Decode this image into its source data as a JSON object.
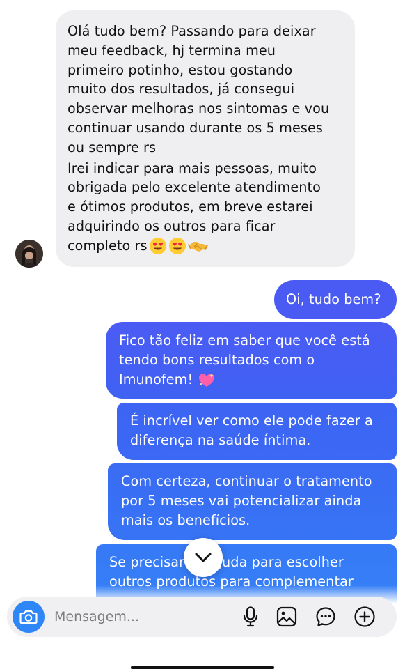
{
  "conversation": {
    "incoming": {
      "paragraph1_lines": [
        "Olá tudo bem? Passando para deixar",
        "meu feedback, hj termina meu",
        "primeiro potinho, estou gostando",
        "muito dos resultados, já consegui",
        "observar melhoras nos sintomas e vou",
        "continuar usando durante os 5 meses",
        "ou sempre rs"
      ],
      "paragraph2_lines": [
        "Irei indicar para mais pessoas, muito",
        "obrigada pelo excelente atendimento",
        "e ótimos produtos, em breve estarei",
        "adquirindo os outros para ficar"
      ],
      "last_line_text": "completo rs",
      "last_line_emojis": [
        "heart-eyes",
        "heart-eyes",
        "handshake"
      ]
    },
    "outgoing": [
      {
        "lines": [
          "Oi, tudo bem?"
        ]
      },
      {
        "lines": [
          "Fico tão feliz em saber que você está",
          "tendo bons resultados com o",
          "Imunofem!"
        ],
        "trailing_emoji": "sparkling-heart"
      },
      {
        "lines": [
          "É incrível ver como ele pode fazer a",
          "diferença na saúde íntima."
        ]
      },
      {
        "lines": [
          "Com certeza, continuar o tratamento",
          "por 5 meses vai potencializar ainda",
          "mais os benefícios."
        ]
      },
      {
        "lines": [
          "Se precisar de ajuda para escolher",
          "outros produtos para complementar"
        ]
      }
    ]
  },
  "composer": {
    "placeholder": "Mensagem...",
    "icons": [
      "camera-icon",
      "microphone-icon",
      "gallery-icon",
      "sticker-icon",
      "plus-icon"
    ]
  },
  "colors": {
    "incoming_bubble": "#efeff1",
    "outgoing_start": "#4a5bf4",
    "outgoing_end": "#3383f7",
    "camera_button": "#2f86f6"
  }
}
